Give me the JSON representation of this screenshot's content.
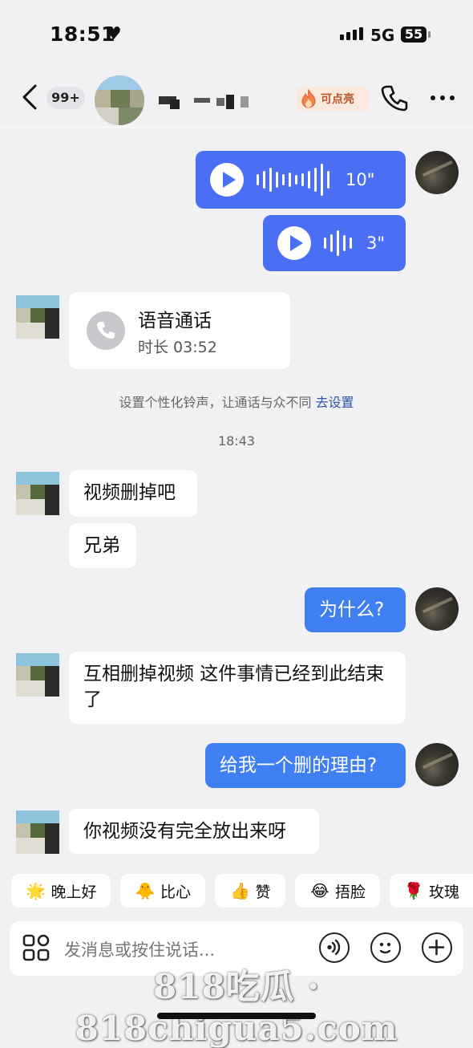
{
  "status_bar": {
    "time": "18:51",
    "heart": "♥",
    "network": "5G",
    "battery": "55"
  },
  "header": {
    "unread_badge": "99+",
    "spark_label": "可点亮"
  },
  "messages": {
    "voice1": {
      "duration": "10\""
    },
    "voice2": {
      "duration": "3\""
    },
    "call": {
      "title": "语音通话",
      "duration": "时长 03:52"
    },
    "system_tip": "设置个性化铃声，让通话与众不同",
    "system_link": "去设置",
    "timestamp": "18:43",
    "m1": "视频删掉吧",
    "m2": "兄弟",
    "m3": "为什么?",
    "m4": "互相删掉视频 这件事情已经到此结束了",
    "m5": "给我一个删的理由?",
    "m6": "你视频没有完全放出来呀"
  },
  "quick_replies": [
    {
      "label": "晚上好",
      "icon": "star-face-icon"
    },
    {
      "label": "比心",
      "icon": "heart-hands-icon"
    },
    {
      "label": "赞",
      "icon": "thumbs-up-icon"
    },
    {
      "label": "捂脸",
      "icon": "facepalm-icon"
    },
    {
      "label": "玫瑰",
      "icon": "rose-icon"
    }
  ],
  "input": {
    "placeholder": "发消息或按住说话..."
  },
  "watermark": "818吃瓜 · 818chigua5.com",
  "colors": {
    "blue_bubble": "#3f7ff2",
    "voice_bubble": "#4a6ff5",
    "link": "#2d55a8",
    "background": "#f1f1f3"
  }
}
